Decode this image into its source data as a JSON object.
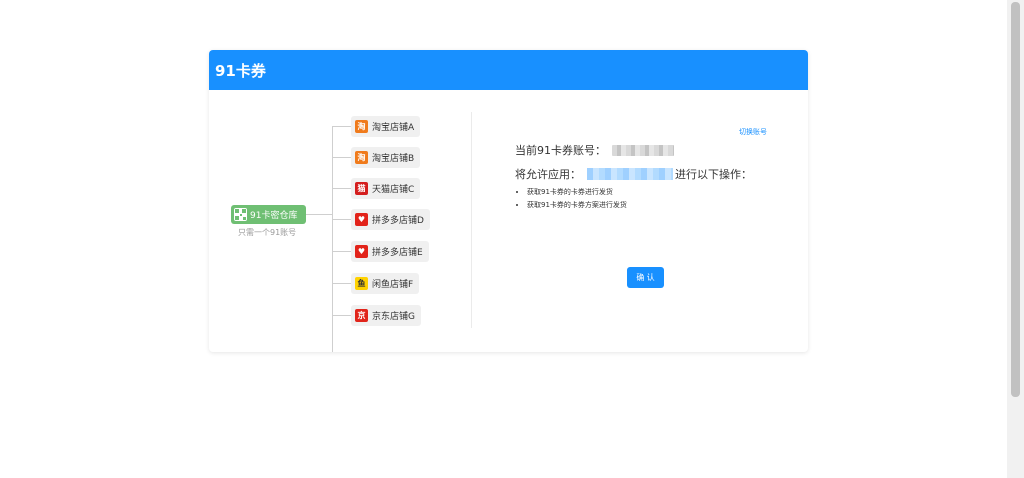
{
  "app": {
    "title": "91卡券"
  },
  "mindmap": {
    "root": {
      "label": "91卡密仓库",
      "sublabel": "只需一个91账号"
    },
    "stores": [
      {
        "label": "淘宝店铺A",
        "icon": "taobao-icon",
        "color": "#f07b1c",
        "glyph": "淘"
      },
      {
        "label": "淘宝店铺B",
        "icon": "taobao-icon",
        "color": "#f07b1c",
        "glyph": "淘"
      },
      {
        "label": "天猫店铺C",
        "icon": "tmall-icon",
        "color": "#d41e1e",
        "glyph": "猫"
      },
      {
        "label": "拼多多店铺D",
        "icon": "pinduoduo-icon",
        "color": "#e2231a",
        "glyph": "♥"
      },
      {
        "label": "拼多多店铺E",
        "icon": "pinduoduo-icon",
        "color": "#e2231a",
        "glyph": "♥"
      },
      {
        "label": "闲鱼店铺F",
        "icon": "xianyu-icon",
        "color": "#ffd200",
        "glyph": "鱼"
      },
      {
        "label": "京东店铺G",
        "icon": "jd-icon",
        "color": "#e1251b",
        "glyph": "京"
      }
    ]
  },
  "auth": {
    "switch_account": "切换账号",
    "current_account_label": "当前91卡券账号：",
    "allow_app_label": "将允许应用：",
    "allow_app_suffix": "进行以下操作：",
    "permissions": [
      "获取91卡券的卡券进行发货",
      "获取91卡券的卡券方案进行发货"
    ],
    "confirm_label": "确 认"
  },
  "colors": {
    "primary": "#1890ff",
    "root_node": "#6fbf73"
  }
}
